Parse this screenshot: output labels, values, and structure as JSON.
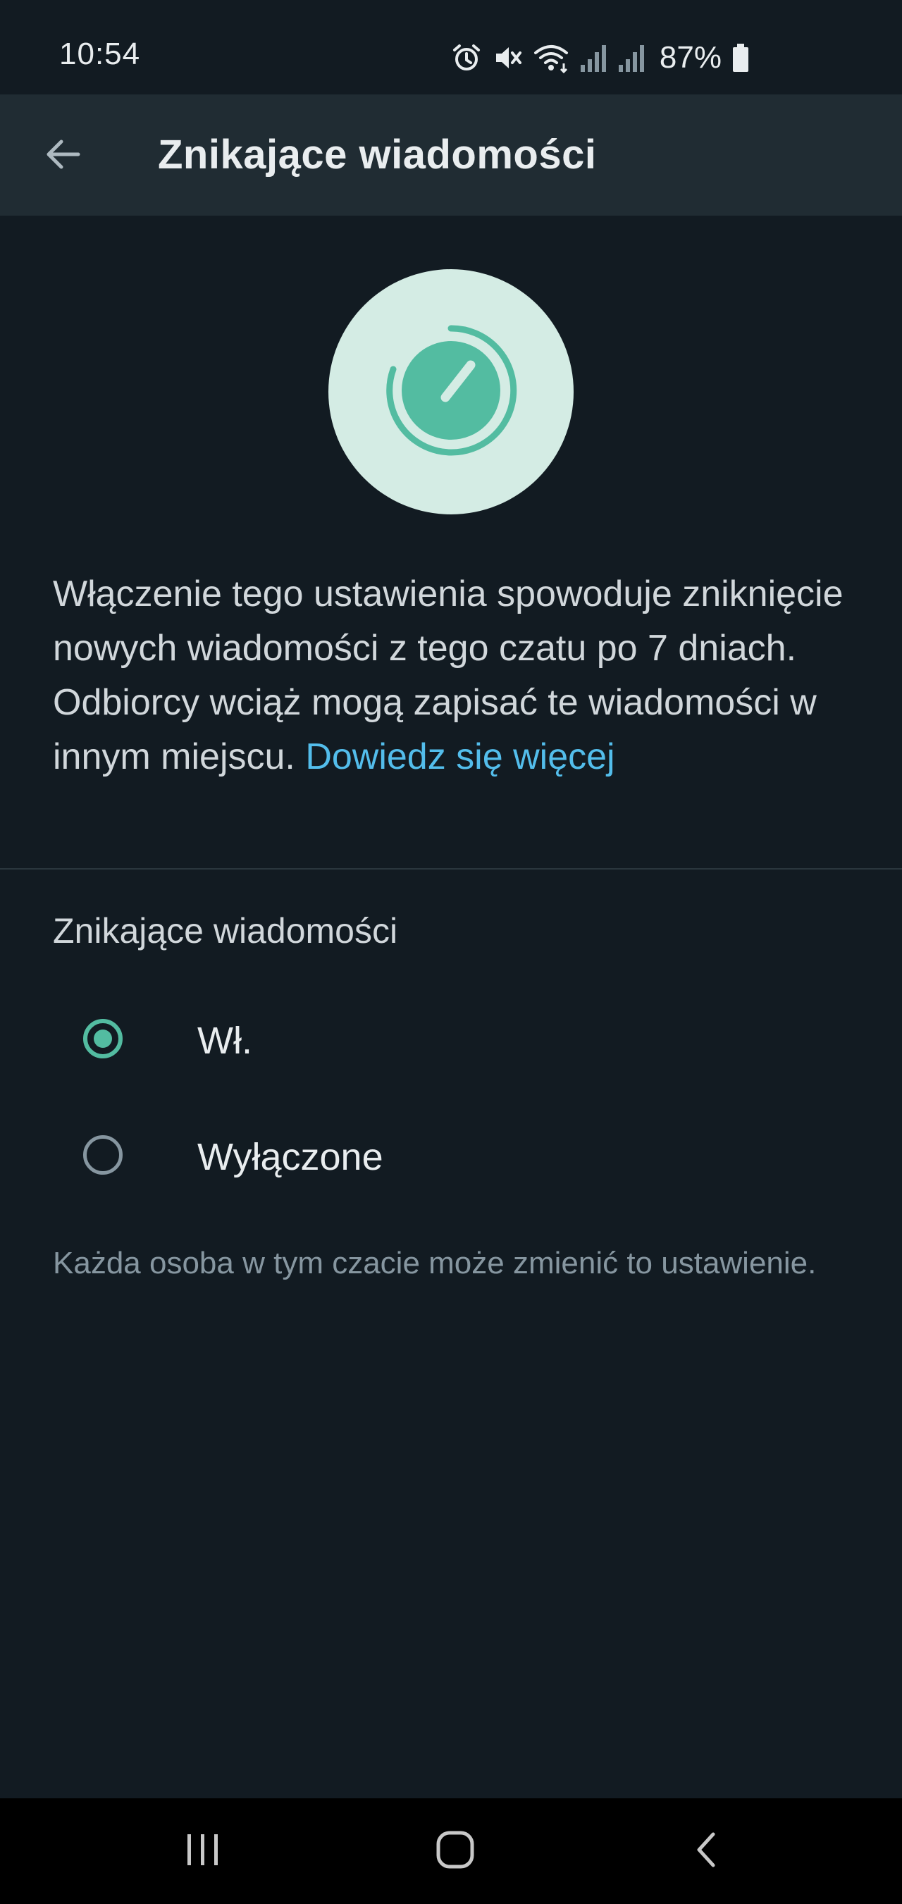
{
  "status_bar": {
    "time": "10:54",
    "battery": "87%",
    "icons": [
      "alarm-icon",
      "mute-icon",
      "wifi-icon",
      "signal-icon",
      "signal-icon",
      "battery-icon"
    ]
  },
  "app_bar": {
    "title": "Znikające wiadomości",
    "back_icon": "arrow-back-icon"
  },
  "hero": {
    "icon": "disappearing-timer-icon"
  },
  "description": {
    "text": "Włączenie tego ustawienia spowoduje zniknięcie nowych wiadomości z tego czatu po 7 dniach. Odbiorcy wciąż mogą zapisać te wiadomości w innym miejscu. ",
    "link": "Dowiedz się więcej"
  },
  "section": {
    "title": "Znikające wiadomości"
  },
  "options": [
    {
      "label": "Wł.",
      "selected": true
    },
    {
      "label": "Wyłączone",
      "selected": false
    }
  ],
  "footnote": "Każda osoba w tym czacie może zmienić to ustawienie.",
  "nav_bar": {
    "icons": [
      "recents-icon",
      "home-icon",
      "back-icon"
    ]
  },
  "colors": {
    "background": "#121b22",
    "app_bar": "#202c33",
    "accent": "#53bca1",
    "link": "#53bdeb",
    "hero_circle": "#d4ece4"
  }
}
